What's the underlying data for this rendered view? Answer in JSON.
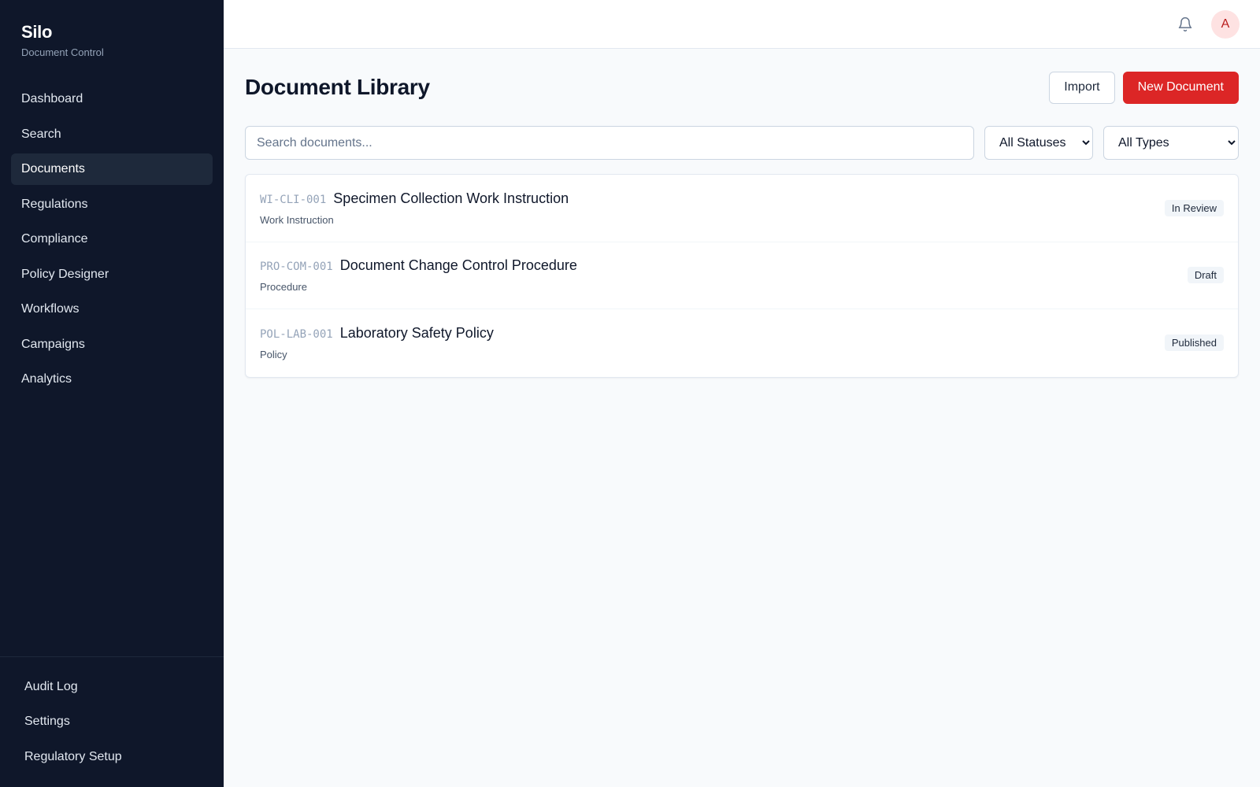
{
  "brand": {
    "title": "Silo",
    "subtitle": "Document Control"
  },
  "sidebar": {
    "items": [
      {
        "label": "Dashboard",
        "active": false
      },
      {
        "label": "Search",
        "active": false
      },
      {
        "label": "Documents",
        "active": true
      },
      {
        "label": "Regulations",
        "active": false
      },
      {
        "label": "Compliance",
        "active": false
      },
      {
        "label": "Policy Designer",
        "active": false
      },
      {
        "label": "Workflows",
        "active": false
      },
      {
        "label": "Campaigns",
        "active": false
      },
      {
        "label": "Analytics",
        "active": false
      }
    ],
    "bottom_items": [
      {
        "label": "Audit Log"
      },
      {
        "label": "Settings"
      },
      {
        "label": "Regulatory Setup"
      }
    ]
  },
  "topbar": {
    "bell_icon": "bell-icon",
    "avatar_initial": "A"
  },
  "page": {
    "title": "Document Library",
    "import_label": "Import",
    "new_document_label": "New Document"
  },
  "filters": {
    "search_placeholder": "Search documents...",
    "search_value": "",
    "status_selected": "All Statuses",
    "type_selected": "All Types"
  },
  "documents": [
    {
      "code": "WI-CLI-001",
      "title": "Specimen Collection Work Instruction",
      "type": "Work Instruction",
      "status": "In Review"
    },
    {
      "code": "PRO-COM-001",
      "title": "Document Change Control Procedure",
      "type": "Procedure",
      "status": "Draft"
    },
    {
      "code": "POL-LAB-001",
      "title": "Laboratory Safety Policy",
      "type": "Policy",
      "status": "Published"
    }
  ],
  "colors": {
    "sidebar_bg": "#0f172a",
    "active_nav_bg": "#1e293b",
    "primary": "#dc2626",
    "avatar_bg": "#fee2e2",
    "avatar_text": "#b91c1c"
  }
}
